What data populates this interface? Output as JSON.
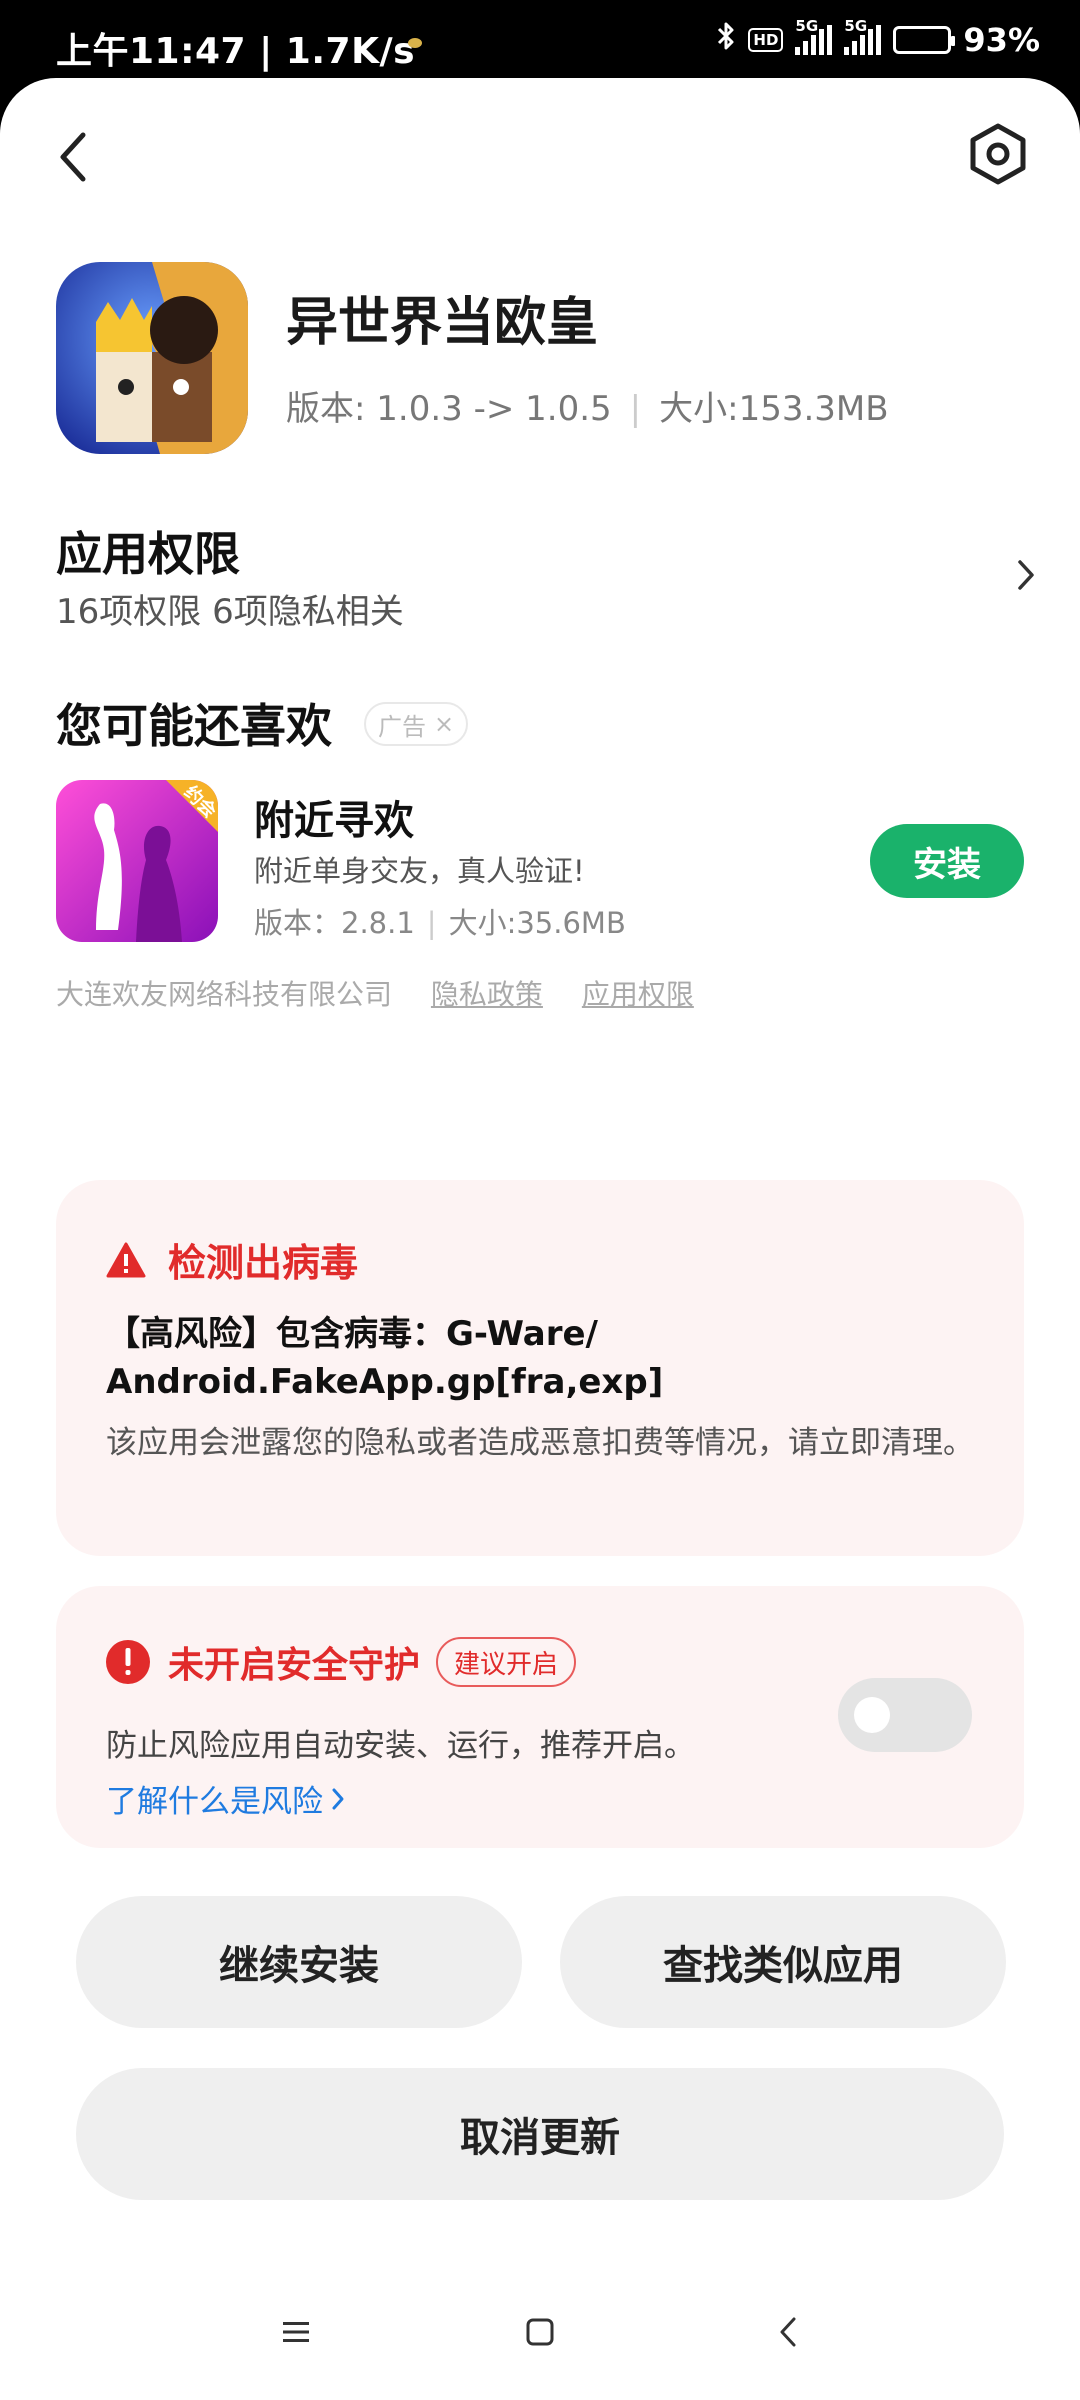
{
  "status_bar": {
    "time_speed": "上午11:47 | 1.7K/s",
    "hd_label": "HD",
    "net1": "5G",
    "net2": "5G",
    "battery": "93%",
    "icons": [
      "bluetooth-icon",
      "hd-icon",
      "signal-icon",
      "battery-icon"
    ]
  },
  "header": {
    "back_icon": "chevron-left-icon",
    "settings_icon": "hexagon-settings-icon"
  },
  "app": {
    "name": "异世界当欧皇",
    "version": "版本: 1.0.3 -> 1.0.5",
    "size": "大小:153.3MB"
  },
  "permissions": {
    "title": "应用权限",
    "summary": "16项权限 6项隐私相关"
  },
  "recommend": {
    "title": "您可能还喜欢",
    "ad_label": "广告",
    "app_name": "附近寻欢",
    "icon_badge": "约会",
    "description": "附近单身交友，真人验证!",
    "version": "版本：2.8.1",
    "size": "大小:35.6MB",
    "install_label": "安装",
    "developer": "大连欢友网络科技有限公司",
    "privacy_link": "隐私政策",
    "permissions_link": "应用权限"
  },
  "virus_warning": {
    "title": "检测出病毒",
    "risk_text": "【高风险】包含病毒：G-Ware/ Android.FakeApp.gp[fra,exp]",
    "description": "该应用会泄露您的隐私或者造成恶意扣费等情况，请立即清理。"
  },
  "protection": {
    "title": "未开启安全守护",
    "suggest_chip": "建议开启",
    "description": "防止风险应用自动安装、运行，推荐开启。",
    "learn_link": "了解什么是风险",
    "toggle_on": false
  },
  "actions": {
    "continue_install": "继续安装",
    "find_similar": "查找类似应用",
    "cancel_update": "取消更新"
  },
  "nav": {
    "menu_icon": "menu-icon",
    "home_icon": "home-square-icon",
    "back_icon": "back-triangle-icon"
  },
  "colors": {
    "danger": "#e12b2b",
    "install_green": "#1ab26b",
    "link_blue": "#1f7be0",
    "card_bg": "#fdf3f3",
    "button_bg": "#efefef"
  }
}
